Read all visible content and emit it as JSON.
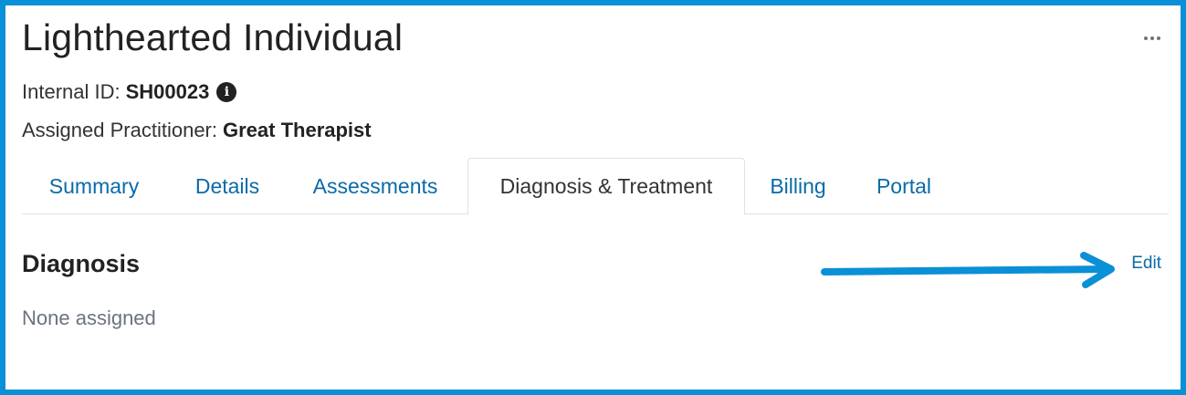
{
  "header": {
    "title": "Lighthearted Individual",
    "internal_id_label": "Internal ID:",
    "internal_id_value": "SH00023",
    "practitioner_label": "Assigned Practitioner:",
    "practitioner_value": "Great Therapist",
    "info_icon_glyph": "i",
    "more_icon": "ellipsis-icon"
  },
  "tabs": [
    {
      "label": "Summary"
    },
    {
      "label": "Details"
    },
    {
      "label": "Assessments"
    },
    {
      "label": "Diagnosis & Treatment",
      "active": true
    },
    {
      "label": "Billing"
    },
    {
      "label": "Portal"
    }
  ],
  "diagnosis": {
    "title": "Diagnosis",
    "empty_text": "None assigned",
    "edit_label": "Edit"
  },
  "annotation": {
    "icon": "arrow-right-icon",
    "color": "#0a90d6"
  },
  "colors": {
    "frame": "#0a90d6",
    "link": "#0b6aa8",
    "muted": "#6b7280"
  }
}
